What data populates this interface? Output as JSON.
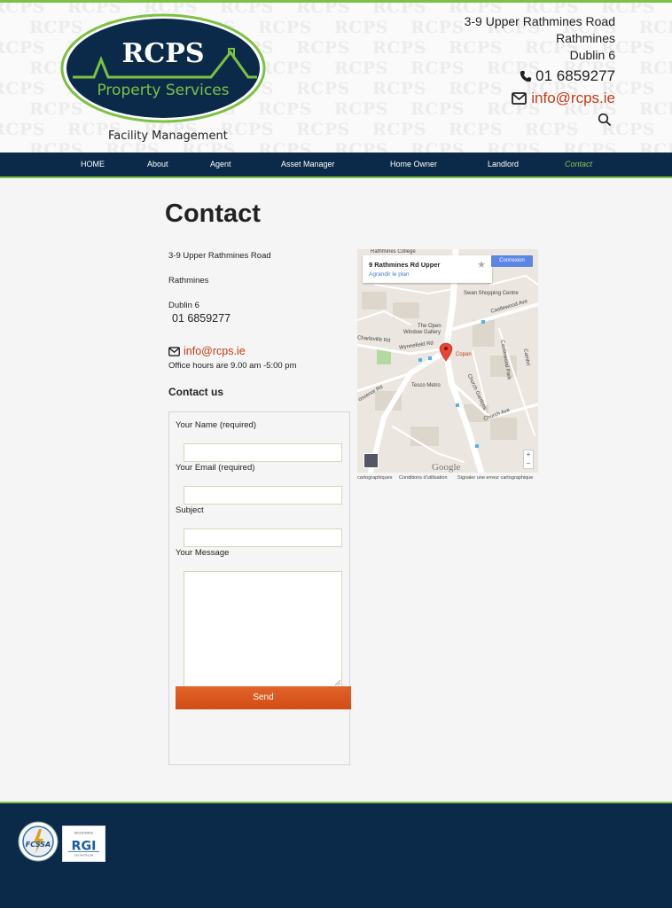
{
  "brand": {
    "name": "RCPS",
    "subtitle": "Property Services",
    "tagline": "Facility Management",
    "watermark": "RCPS",
    "colors": {
      "navy": "#0b2a4a",
      "green": "#7dc142",
      "orange": "#d9541c",
      "link_red": "#c63a12"
    }
  },
  "header_contact": {
    "address_line1": "3-9 Upper Rathmines Road",
    "address_line2": "Rathmines",
    "address_line3": "Dublin 6",
    "phone": "01 6859277",
    "email": "info@rcps.ie",
    "phone_icon": "phone-icon",
    "email_icon": "envelope-icon",
    "search_icon": "search-icon"
  },
  "nav": {
    "items": [
      {
        "label": "HOME"
      },
      {
        "label": "About"
      },
      {
        "label": "Agent"
      },
      {
        "label": "Asset Manager"
      },
      {
        "label": "Home Owner"
      },
      {
        "label": "Landlord"
      },
      {
        "label": "Contact",
        "active": true
      }
    ]
  },
  "page": {
    "title": "Contact",
    "address_line1": "3-9 Upper Rathmines Road",
    "address_line2": "Rathmines",
    "address_line3": "Dublin 6",
    "phone": "01 6859277",
    "email": "info@rcps.ie",
    "office_hours": "Office hours are 9.00 am -5:00 pm",
    "contact_heading": "Contact us"
  },
  "form": {
    "name_label": "Your Name (required)",
    "name_value": "",
    "email_label": "Your Email (required)",
    "email_value": "",
    "subject_label": "Subject",
    "subject_value": "",
    "message_label": "Your Message",
    "message_value": "",
    "send_label": "Send"
  },
  "map": {
    "place_title": "9 Rathmines Rd Upper",
    "enlarge_link": "Agrandir le plan",
    "signin": "Connexion",
    "labels": {
      "college": "Rathmines College",
      "swan": "Swan Shopping Centre",
      "castlewood_ave": "Castlewood Ave",
      "open_window": "The Open",
      "open_window2": "Window Gallery",
      "charleville": "Charleville Rd",
      "wynnefield": "Wynnefield Rd",
      "copan": "Copan",
      "tesco": "Tesco Metro",
      "church_gardens": "Church Gardens",
      "castlewood_park": "Castlewood Park",
      "church_ave": "Church Ave",
      "grosvenor": "osvenor Rd",
      "cambridge": "Cambri"
    },
    "watermark": "Google",
    "zoom_in": "+",
    "zoom_out": "−",
    "footer_data": "cartographiques",
    "footer_terms": "Conditions d'utilisation",
    "footer_report": "Signaler une erreur cartographique"
  },
  "footer": {
    "badge1_icon": "fcsa-badge-icon",
    "badge1_text": "FCSSA",
    "badge2_icon": "rgi-badge-icon",
    "badge2_text": "RGI",
    "badge2_caption": "REGISTERED",
    "badge2_sub": "GAS INSTALLER"
  }
}
